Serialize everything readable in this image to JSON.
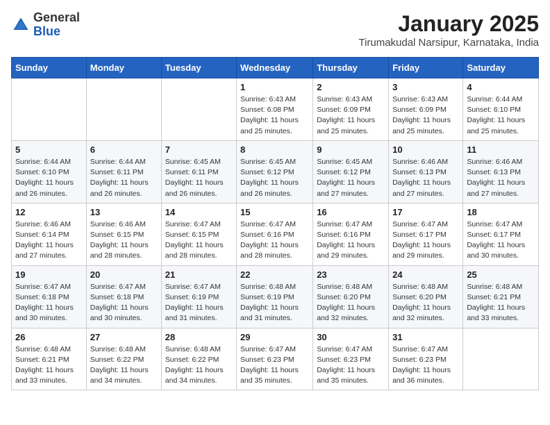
{
  "header": {
    "logo_general": "General",
    "logo_blue": "Blue",
    "title": "January 2025",
    "subtitle": "Tirumakudal Narsipur, Karnataka, India"
  },
  "days_of_week": [
    "Sunday",
    "Monday",
    "Tuesday",
    "Wednesday",
    "Thursday",
    "Friday",
    "Saturday"
  ],
  "weeks": [
    [
      {
        "day": "",
        "sunrise": "",
        "sunset": "",
        "daylight": ""
      },
      {
        "day": "",
        "sunrise": "",
        "sunset": "",
        "daylight": ""
      },
      {
        "day": "",
        "sunrise": "",
        "sunset": "",
        "daylight": ""
      },
      {
        "day": "1",
        "sunrise": "Sunrise: 6:43 AM",
        "sunset": "Sunset: 6:08 PM",
        "daylight": "Daylight: 11 hours and 25 minutes."
      },
      {
        "day": "2",
        "sunrise": "Sunrise: 6:43 AM",
        "sunset": "Sunset: 6:09 PM",
        "daylight": "Daylight: 11 hours and 25 minutes."
      },
      {
        "day": "3",
        "sunrise": "Sunrise: 6:43 AM",
        "sunset": "Sunset: 6:09 PM",
        "daylight": "Daylight: 11 hours and 25 minutes."
      },
      {
        "day": "4",
        "sunrise": "Sunrise: 6:44 AM",
        "sunset": "Sunset: 6:10 PM",
        "daylight": "Daylight: 11 hours and 25 minutes."
      }
    ],
    [
      {
        "day": "5",
        "sunrise": "Sunrise: 6:44 AM",
        "sunset": "Sunset: 6:10 PM",
        "daylight": "Daylight: 11 hours and 26 minutes."
      },
      {
        "day": "6",
        "sunrise": "Sunrise: 6:44 AM",
        "sunset": "Sunset: 6:11 PM",
        "daylight": "Daylight: 11 hours and 26 minutes."
      },
      {
        "day": "7",
        "sunrise": "Sunrise: 6:45 AM",
        "sunset": "Sunset: 6:11 PM",
        "daylight": "Daylight: 11 hours and 26 minutes."
      },
      {
        "day": "8",
        "sunrise": "Sunrise: 6:45 AM",
        "sunset": "Sunset: 6:12 PM",
        "daylight": "Daylight: 11 hours and 26 minutes."
      },
      {
        "day": "9",
        "sunrise": "Sunrise: 6:45 AM",
        "sunset": "Sunset: 6:12 PM",
        "daylight": "Daylight: 11 hours and 27 minutes."
      },
      {
        "day": "10",
        "sunrise": "Sunrise: 6:46 AM",
        "sunset": "Sunset: 6:13 PM",
        "daylight": "Daylight: 11 hours and 27 minutes."
      },
      {
        "day": "11",
        "sunrise": "Sunrise: 6:46 AM",
        "sunset": "Sunset: 6:13 PM",
        "daylight": "Daylight: 11 hours and 27 minutes."
      }
    ],
    [
      {
        "day": "12",
        "sunrise": "Sunrise: 6:46 AM",
        "sunset": "Sunset: 6:14 PM",
        "daylight": "Daylight: 11 hours and 27 minutes."
      },
      {
        "day": "13",
        "sunrise": "Sunrise: 6:46 AM",
        "sunset": "Sunset: 6:15 PM",
        "daylight": "Daylight: 11 hours and 28 minutes."
      },
      {
        "day": "14",
        "sunrise": "Sunrise: 6:47 AM",
        "sunset": "Sunset: 6:15 PM",
        "daylight": "Daylight: 11 hours and 28 minutes."
      },
      {
        "day": "15",
        "sunrise": "Sunrise: 6:47 AM",
        "sunset": "Sunset: 6:16 PM",
        "daylight": "Daylight: 11 hours and 28 minutes."
      },
      {
        "day": "16",
        "sunrise": "Sunrise: 6:47 AM",
        "sunset": "Sunset: 6:16 PM",
        "daylight": "Daylight: 11 hours and 29 minutes."
      },
      {
        "day": "17",
        "sunrise": "Sunrise: 6:47 AM",
        "sunset": "Sunset: 6:17 PM",
        "daylight": "Daylight: 11 hours and 29 minutes."
      },
      {
        "day": "18",
        "sunrise": "Sunrise: 6:47 AM",
        "sunset": "Sunset: 6:17 PM",
        "daylight": "Daylight: 11 hours and 30 minutes."
      }
    ],
    [
      {
        "day": "19",
        "sunrise": "Sunrise: 6:47 AM",
        "sunset": "Sunset: 6:18 PM",
        "daylight": "Daylight: 11 hours and 30 minutes."
      },
      {
        "day": "20",
        "sunrise": "Sunrise: 6:47 AM",
        "sunset": "Sunset: 6:18 PM",
        "daylight": "Daylight: 11 hours and 30 minutes."
      },
      {
        "day": "21",
        "sunrise": "Sunrise: 6:47 AM",
        "sunset": "Sunset: 6:19 PM",
        "daylight": "Daylight: 11 hours and 31 minutes."
      },
      {
        "day": "22",
        "sunrise": "Sunrise: 6:48 AM",
        "sunset": "Sunset: 6:19 PM",
        "daylight": "Daylight: 11 hours and 31 minutes."
      },
      {
        "day": "23",
        "sunrise": "Sunrise: 6:48 AM",
        "sunset": "Sunset: 6:20 PM",
        "daylight": "Daylight: 11 hours and 32 minutes."
      },
      {
        "day": "24",
        "sunrise": "Sunrise: 6:48 AM",
        "sunset": "Sunset: 6:20 PM",
        "daylight": "Daylight: 11 hours and 32 minutes."
      },
      {
        "day": "25",
        "sunrise": "Sunrise: 6:48 AM",
        "sunset": "Sunset: 6:21 PM",
        "daylight": "Daylight: 11 hours and 33 minutes."
      }
    ],
    [
      {
        "day": "26",
        "sunrise": "Sunrise: 6:48 AM",
        "sunset": "Sunset: 6:21 PM",
        "daylight": "Daylight: 11 hours and 33 minutes."
      },
      {
        "day": "27",
        "sunrise": "Sunrise: 6:48 AM",
        "sunset": "Sunset: 6:22 PM",
        "daylight": "Daylight: 11 hours and 34 minutes."
      },
      {
        "day": "28",
        "sunrise": "Sunrise: 6:48 AM",
        "sunset": "Sunset: 6:22 PM",
        "daylight": "Daylight: 11 hours and 34 minutes."
      },
      {
        "day": "29",
        "sunrise": "Sunrise: 6:47 AM",
        "sunset": "Sunset: 6:23 PM",
        "daylight": "Daylight: 11 hours and 35 minutes."
      },
      {
        "day": "30",
        "sunrise": "Sunrise: 6:47 AM",
        "sunset": "Sunset: 6:23 PM",
        "daylight": "Daylight: 11 hours and 35 minutes."
      },
      {
        "day": "31",
        "sunrise": "Sunrise: 6:47 AM",
        "sunset": "Sunset: 6:23 PM",
        "daylight": "Daylight: 11 hours and 36 minutes."
      },
      {
        "day": "",
        "sunrise": "",
        "sunset": "",
        "daylight": ""
      }
    ]
  ]
}
